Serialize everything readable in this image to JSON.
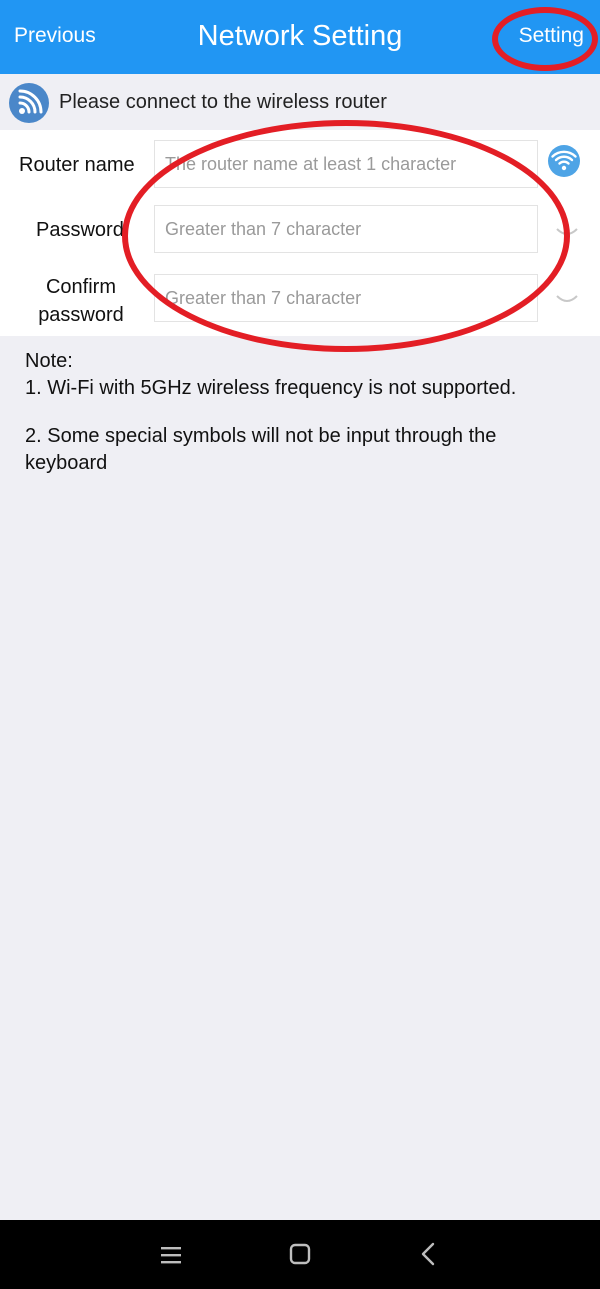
{
  "header": {
    "previous_label": "Previous",
    "title": "Network Setting",
    "setting_label": "Setting"
  },
  "hint": {
    "icon": "wifi-signal-icon",
    "text": "Please connect to the wireless router"
  },
  "form": {
    "router_name": {
      "label": "Router name",
      "value": "",
      "placeholder": "The router name at least 1 character"
    },
    "password": {
      "label": "Password",
      "value": "",
      "placeholder": "Greater than 7 character"
    },
    "confirm_password": {
      "label_line1": "Confirm",
      "label_line2": "password",
      "value": "",
      "placeholder": "Greater than 7 character"
    }
  },
  "notes": {
    "heading": "Note:",
    "item1": "1. Wi-Fi with 5GHz wireless frequency is not supported.",
    "item2_line1": "2. Some special symbols will not be input through the",
    "item2_line2": "keyboard"
  },
  "colors": {
    "header": "#2196f3",
    "annotation": "#e31e25",
    "background": "#efeff4"
  }
}
